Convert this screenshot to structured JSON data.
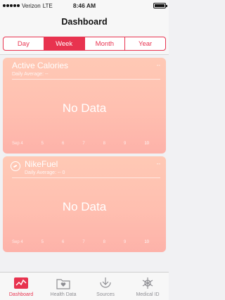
{
  "status_bar": {
    "carrier": "Verizon",
    "network": "LTE",
    "time": "8:46 AM"
  },
  "nav": {
    "title": "Dashboard"
  },
  "segments": {
    "items": [
      "Day",
      "Week",
      "Month",
      "Year"
    ],
    "selected": "Week"
  },
  "cards": [
    {
      "title": "Active Calories",
      "subtitle": "Daily Average: --",
      "value_dash": "--",
      "empty_message": "No Data",
      "axis_labels": [
        "Sep 4",
        "5",
        "6",
        "7",
        "8",
        "9",
        "10"
      ]
    },
    {
      "title": "NikeFuel",
      "subtitle": "Daily Average: -- 0",
      "value_dash": "--",
      "empty_message": "No Data",
      "axis_labels": [
        "Sep 4",
        "5",
        "6",
        "7",
        "8",
        "9",
        "10"
      ]
    }
  ],
  "tabs": {
    "items": [
      {
        "label": "Dashboard",
        "icon": "dashboard-icon"
      },
      {
        "label": "Health Data",
        "icon": "health-data-icon"
      },
      {
        "label": "Sources",
        "icon": "sources-icon"
      },
      {
        "label": "Medical ID",
        "icon": "medical-id-icon"
      }
    ],
    "selected": "Dashboard"
  },
  "colors": {
    "accent": "#e8334f",
    "card_top": "#ffc9b5",
    "card_bottom": "#fdb2a9"
  }
}
